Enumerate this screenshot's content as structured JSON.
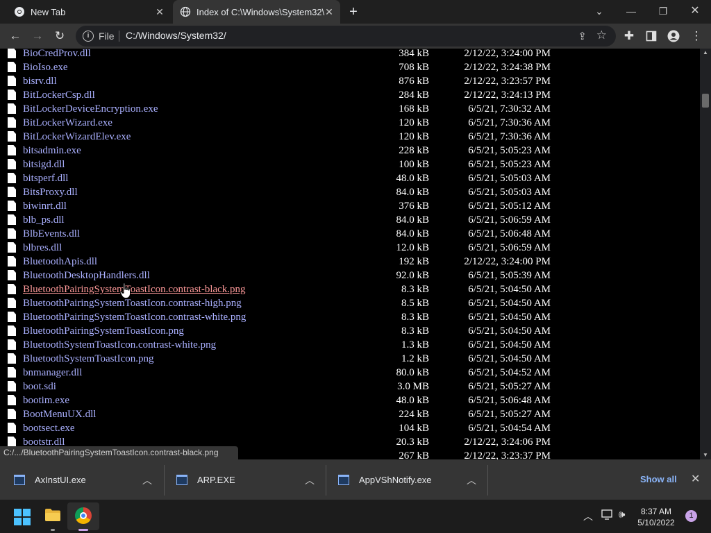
{
  "tabs": [
    {
      "title": "New Tab"
    },
    {
      "title": "Index of C:\\Windows\\System32\\"
    }
  ],
  "toolbar": {
    "scheme_label": "File",
    "url": "C:/Windows/System32/"
  },
  "files": [
    {
      "name": "BioCredProv.dll",
      "size": "384 kB",
      "modified": "2/12/22, 3:24:00 PM"
    },
    {
      "name": "BioIso.exe",
      "size": "708 kB",
      "modified": "2/12/22, 3:24:38 PM"
    },
    {
      "name": "bisrv.dll",
      "size": "876 kB",
      "modified": "2/12/22, 3:23:57 PM"
    },
    {
      "name": "BitLockerCsp.dll",
      "size": "284 kB",
      "modified": "2/12/22, 3:24:13 PM"
    },
    {
      "name": "BitLockerDeviceEncryption.exe",
      "size": "168 kB",
      "modified": "6/5/21, 7:30:32 AM"
    },
    {
      "name": "BitLockerWizard.exe",
      "size": "120 kB",
      "modified": "6/5/21, 7:30:36 AM"
    },
    {
      "name": "BitLockerWizardElev.exe",
      "size": "120 kB",
      "modified": "6/5/21, 7:30:36 AM"
    },
    {
      "name": "bitsadmin.exe",
      "size": "228 kB",
      "modified": "6/5/21, 5:05:23 AM"
    },
    {
      "name": "bitsigd.dll",
      "size": "100 kB",
      "modified": "6/5/21, 5:05:23 AM"
    },
    {
      "name": "bitsperf.dll",
      "size": "48.0 kB",
      "modified": "6/5/21, 5:05:03 AM"
    },
    {
      "name": "BitsProxy.dll",
      "size": "84.0 kB",
      "modified": "6/5/21, 5:05:03 AM"
    },
    {
      "name": "biwinrt.dll",
      "size": "376 kB",
      "modified": "6/5/21, 5:05:12 AM"
    },
    {
      "name": "blb_ps.dll",
      "size": "84.0 kB",
      "modified": "6/5/21, 5:06:59 AM"
    },
    {
      "name": "BlbEvents.dll",
      "size": "84.0 kB",
      "modified": "6/5/21, 5:06:48 AM"
    },
    {
      "name": "blbres.dll",
      "size": "12.0 kB",
      "modified": "6/5/21, 5:06:59 AM"
    },
    {
      "name": "BluetoothApis.dll",
      "size": "192 kB",
      "modified": "2/12/22, 3:24:00 PM"
    },
    {
      "name": "BluetoothDesktopHandlers.dll",
      "size": "92.0 kB",
      "modified": "6/5/21, 5:05:39 AM"
    },
    {
      "name": "BluetoothPairingSystemToastIcon.contrast-black.png",
      "size": "8.3 kB",
      "modified": "6/5/21, 5:04:50 AM"
    },
    {
      "name": "BluetoothPairingSystemToastIcon.contrast-high.png",
      "size": "8.5 kB",
      "modified": "6/5/21, 5:04:50 AM"
    },
    {
      "name": "BluetoothPairingSystemToastIcon.contrast-white.png",
      "size": "8.3 kB",
      "modified": "6/5/21, 5:04:50 AM"
    },
    {
      "name": "BluetoothPairingSystemToastIcon.png",
      "size": "8.3 kB",
      "modified": "6/5/21, 5:04:50 AM"
    },
    {
      "name": "BluetoothSystemToastIcon.contrast-white.png",
      "size": "1.3 kB",
      "modified": "6/5/21, 5:04:50 AM"
    },
    {
      "name": "BluetoothSystemToastIcon.png",
      "size": "1.2 kB",
      "modified": "6/5/21, 5:04:50 AM"
    },
    {
      "name": "bnmanager.dll",
      "size": "80.0 kB",
      "modified": "6/5/21, 5:04:52 AM"
    },
    {
      "name": "boot.sdi",
      "size": "3.0 MB",
      "modified": "6/5/21, 5:05:27 AM"
    },
    {
      "name": "bootim.exe",
      "size": "48.0 kB",
      "modified": "6/5/21, 5:06:48 AM"
    },
    {
      "name": "BootMenuUX.dll",
      "size": "224 kB",
      "modified": "6/5/21, 5:05:27 AM"
    },
    {
      "name": "bootsect.exe",
      "size": "104 kB",
      "modified": "6/5/21, 5:04:54 AM"
    },
    {
      "name": "bootstr.dll",
      "size": "20.3 kB",
      "modified": "2/12/22, 3:24:06 PM"
    },
    {
      "name": "",
      "size": "267 kB",
      "modified": "2/12/22, 3:23:37 PM"
    }
  ],
  "hovered_index": 17,
  "status_url": "C:/.../BluetoothPairingSystemToastIcon.contrast-black.png",
  "downloads": {
    "items": [
      {
        "name": "AxInstUI.exe"
      },
      {
        "name": "ARP.EXE"
      },
      {
        "name": "AppVShNotify.exe"
      }
    ],
    "show_all": "Show all"
  },
  "taskbar": {
    "time": "8:37 AM",
    "date": "5/10/2022",
    "notifications": "1"
  },
  "colors": {
    "link": "#aab0ff",
    "link_hover": "#ff9a9a",
    "accent": "#8ab4f8"
  }
}
